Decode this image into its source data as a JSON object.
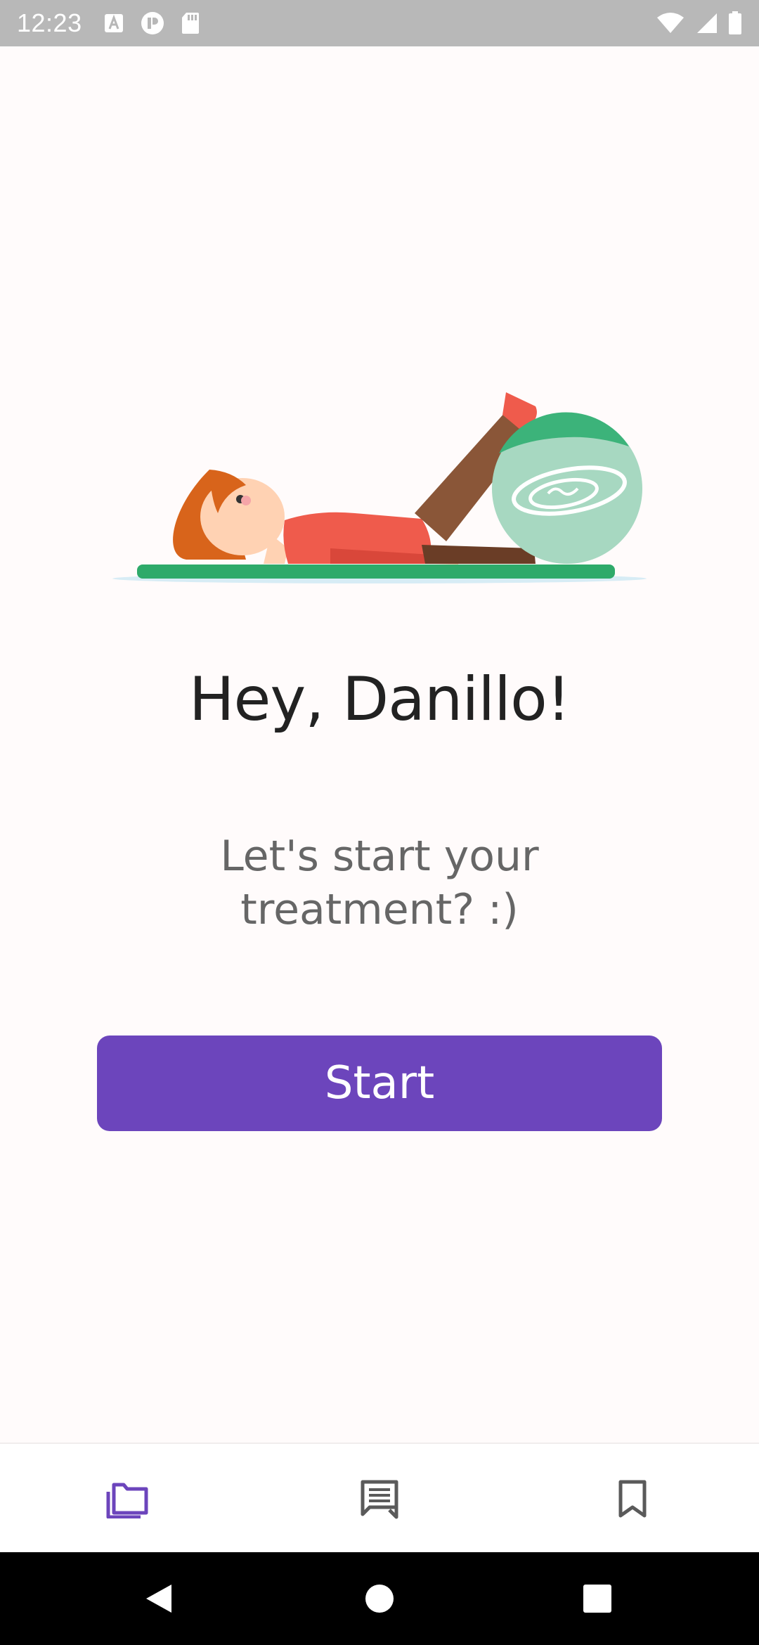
{
  "status_bar": {
    "time": "12:23",
    "icons": [
      "a-box-icon",
      "app-notification-icon",
      "sd-card-icon",
      "wifi-icon",
      "cell-signal-icon",
      "battery-icon"
    ]
  },
  "illustration": {
    "name": "woman-exercising-with-ball-illustration"
  },
  "main": {
    "greeting": "Hey, Danillo!",
    "subtitle": "Let's start your treatment? :)",
    "start_label": "Start"
  },
  "bottom_nav": {
    "items": [
      {
        "icon": "folders-icon",
        "active": true
      },
      {
        "icon": "messages-icon",
        "active": false
      },
      {
        "icon": "bookmark-icon",
        "active": false
      }
    ]
  },
  "system_nav": {
    "buttons": [
      "back-icon",
      "home-icon",
      "recents-icon"
    ]
  },
  "colors": {
    "accent": "#6c45bc",
    "status_bar": "#b8b8b8",
    "background": "#fffbfb",
    "inactive_icon": "#5a5a5a"
  }
}
